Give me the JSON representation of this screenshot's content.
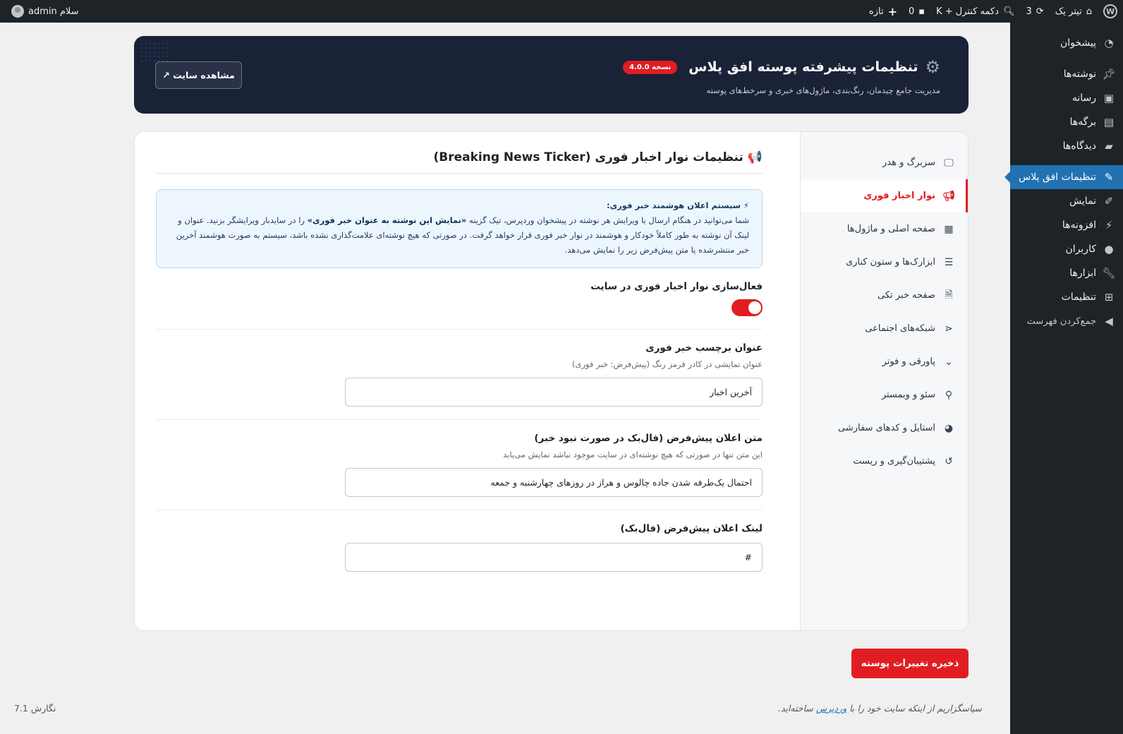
{
  "admin_bar": {
    "site_name": "تیتر یک",
    "updates_count": "3",
    "search_shortcut": "دکمه کنترل + K",
    "comments_count": "0",
    "new_label": "تازه",
    "greeting": "سلام admin"
  },
  "admin_menu": [
    {
      "label": "پیشخوان",
      "icon": "dashboard-icon"
    },
    {
      "label": "نوشته‌ها",
      "icon": "pin-icon"
    },
    {
      "label": "رسانه",
      "icon": "media-icon"
    },
    {
      "label": "برگه‌ها",
      "icon": "pages-icon"
    },
    {
      "label": "دیدگاه‌ها",
      "icon": "comments-icon"
    },
    {
      "label": "تنظیمات افق پلاس",
      "icon": "brush-icon"
    },
    {
      "label": "نمایش",
      "icon": "appearance-icon"
    },
    {
      "label": "افزونه‌ها",
      "icon": "plugins-icon"
    },
    {
      "label": "کاربران",
      "icon": "users-icon"
    },
    {
      "label": "ابزارها",
      "icon": "tools-icon"
    },
    {
      "label": "تنظیمات",
      "icon": "settings-icon"
    },
    {
      "label": "جمع‌کردن فهرست",
      "icon": "collapse-icon"
    }
  ],
  "hero": {
    "title": "تنظیمات پیشرفته پوسته افق پلاس",
    "version": "نسخه 4.0.0",
    "subtitle": "مدیریت جامع چیدمان، رنگ‌بندی، ماژول‌های خبری و سرخط‌های پوسته",
    "view_site": "مشاهده سایت ↗"
  },
  "tabs": [
    {
      "label": "سربرگ و هدر",
      "icon": "monitor-icon"
    },
    {
      "label": "نوار اخبار فوری",
      "icon": "megaphone-icon"
    },
    {
      "label": "صفحه اصلی و ماژول‌ها",
      "icon": "layout-icon"
    },
    {
      "label": "ابزارک‌ها و ستون کناری",
      "icon": "table-icon"
    },
    {
      "label": "صفحه خبر تکی",
      "icon": "document-icon"
    },
    {
      "label": "شبکه‌های اجتماعی",
      "icon": "share-icon"
    },
    {
      "label": "پاورقی و فوتر",
      "icon": "chevron-down-icon"
    },
    {
      "label": "سئو و وبمستر",
      "icon": "search-icon"
    },
    {
      "label": "استایل و کدهای سفارشی",
      "icon": "palette-icon"
    },
    {
      "label": "پشتیبان‌گیری و ریست",
      "icon": "history-icon"
    }
  ],
  "section": {
    "icon": "📢",
    "title": "تنظیمات نوار اخبار فوری (Breaking News Ticker)"
  },
  "info": {
    "title": "⚡ سیستم اعلان هوشمند خبر فوری:",
    "text_part1": "شما می‌توانید در هنگام ارسال یا ویرایش هر نوشته در پیشخوان وردپرس، تیک گزینه ",
    "text_bold": "«نمایش این نوشته به عنوان خبر فوری»",
    "text_part2": " را در سایدبار ویرایشگر بزنید. عنوان و لینک آن نوشته به طور کاملاً خودکار و هوشمند در نوار خبر فوری قرار خواهد گرفت. در صورتی که هیچ نوشته‌ای علامت‌گذاری نشده باشد، سیستم به صورت هوشمند آخرین خبر منتشرشده یا متن پیش‌فرض زیر را نمایش می‌دهد."
  },
  "fields": {
    "enable": {
      "label": "فعال‌سازی نوار اخبار فوری در سایت",
      "enabled": true
    },
    "badge_title": {
      "label": "عنوان برچسب خبر فوری",
      "desc": "عنوان نمایشی در کادر قرمز رنگ (پیش‌فرض: خبر فوری)",
      "value": "آخرین اخبار"
    },
    "fallback_text": {
      "label": "متن اعلان پیش‌فرض (فال‌بک در صورت نبود خبر)",
      "desc": "این متن تنها در صورتی که هیچ نوشته‌ای در سایت موجود نباشد نمایش می‌یابد",
      "value": "احتمال یک‌طرفه شدن جاده چالوس و هراز در روزهای چهارشنبه و جمعه"
    },
    "fallback_link": {
      "label": "لینک اعلان پیش‌فرض (فال‌بک)",
      "value": "#"
    }
  },
  "save_button": "ذخیره تغییرات پوسته",
  "footer": {
    "thanks_prefix": "سپاسگزاریم از اینکه سایت خود را با ",
    "thanks_link": "وردپرس",
    "thanks_suffix": " ساخته‌اید.",
    "version": "نگارش 7.1"
  },
  "colors": {
    "accent": "#e11d22",
    "hero_bg": "#1a2238",
    "admin_bar": "#1d2327",
    "menu_current": "#2271b1"
  }
}
